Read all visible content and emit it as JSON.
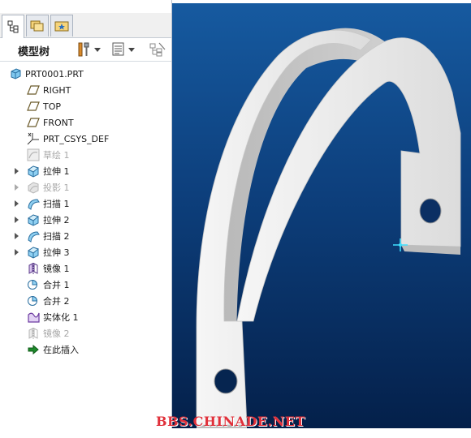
{
  "model_tree": {
    "title": "模型树",
    "items": [
      {
        "label": "PRT0001.PRT",
        "icon": "part-icon",
        "expandable": false,
        "disabled": false
      },
      {
        "label": "RIGHT",
        "icon": "datum-plane-icon",
        "expandable": false,
        "disabled": false
      },
      {
        "label": "TOP",
        "icon": "datum-plane-icon",
        "expandable": false,
        "disabled": false
      },
      {
        "label": "FRONT",
        "icon": "datum-plane-icon",
        "expandable": false,
        "disabled": false
      },
      {
        "label": "PRT_CSYS_DEF",
        "icon": "csys-icon",
        "expandable": false,
        "disabled": false
      },
      {
        "label": "草绘 1",
        "icon": "sketch-icon",
        "expandable": false,
        "disabled": true
      },
      {
        "label": "拉伸 1",
        "icon": "extrude-icon",
        "expandable": true,
        "disabled": false
      },
      {
        "label": "投影 1",
        "icon": "projection-icon",
        "expandable": true,
        "disabled": true
      },
      {
        "label": "扫描 1",
        "icon": "sweep-icon",
        "expandable": true,
        "disabled": false
      },
      {
        "label": "拉伸 2",
        "icon": "extrude-icon",
        "expandable": true,
        "disabled": false
      },
      {
        "label": "扫描 2",
        "icon": "sweep-icon",
        "expandable": true,
        "disabled": false
      },
      {
        "label": "拉伸 3",
        "icon": "extrude-icon",
        "expandable": true,
        "disabled": false
      },
      {
        "label": "镜像 1",
        "icon": "mirror-icon",
        "expandable": false,
        "disabled": false
      },
      {
        "label": "合并 1",
        "icon": "merge-icon",
        "expandable": false,
        "disabled": false
      },
      {
        "label": "合并 2",
        "icon": "merge-icon",
        "expandable": false,
        "disabled": false
      },
      {
        "label": "实体化 1",
        "icon": "solidify-icon",
        "expandable": false,
        "disabled": false
      },
      {
        "label": "镜像 2",
        "icon": "mirror-icon",
        "expandable": false,
        "disabled": true
      },
      {
        "label": "在此插入",
        "icon": "insert-arrow-icon",
        "expandable": false,
        "disabled": false
      }
    ]
  },
  "tabs": [
    {
      "icon": "model-tree-tab-icon"
    },
    {
      "icon": "folder-browser-tab-icon"
    },
    {
      "icon": "favorites-tab-icon"
    }
  ],
  "toolbar": {
    "settings_icon": "tools-icon",
    "show_icon": "tree-columns-icon",
    "filter_icon": "tree-filter-icon"
  },
  "colors": {
    "viewport_top": "#165aa0",
    "viewport_bottom": "#04204a",
    "model_face": "#f2f2f2",
    "watermark": "#e0303a"
  },
  "watermark": "BBS.CHINADE.NET"
}
